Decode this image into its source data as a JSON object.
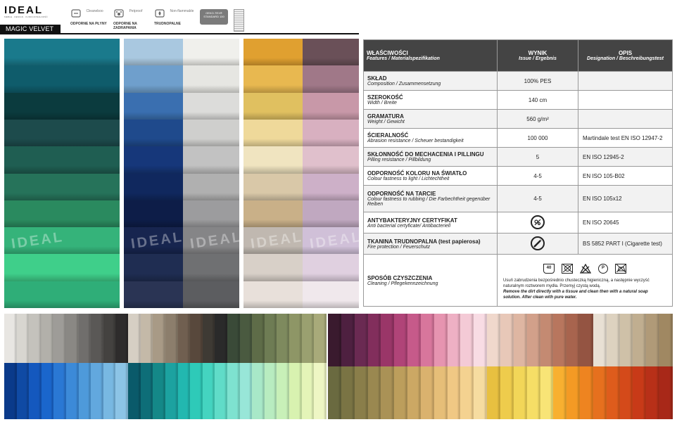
{
  "header": {
    "logo": "IDEAL",
    "logo_tag": "MEBLE · DESIGN · FUNKCJONALNOŚĆ",
    "product_name": "MAGIC VELVET",
    "badges": [
      {
        "icon": "cleaning-icon",
        "en": "Cleaneboo",
        "pl": "ODPORNE NA PŁYNY"
      },
      {
        "icon": "petproof-icon",
        "en": "Petproof",
        "pl": "ODPORNE NA ZADRAPANIA"
      },
      {
        "icon": "flame-icon",
        "en": "Non-flammable",
        "pl": "TRUDNOPALNE"
      }
    ],
    "oeko_text": "OEKO-TEX® STANDARD 100",
    "watermark": "IDEAL"
  },
  "spec_table": {
    "headers": [
      {
        "pl": "WŁAŚCIWOŚCI",
        "en": "Features / Materialspezifikation"
      },
      {
        "pl": "WYNIK",
        "en": "Issue / Ergebnis"
      },
      {
        "pl": "OPIS",
        "en": "Designation / Beschreibungstest"
      }
    ],
    "rows": [
      {
        "pl": "SKŁAD",
        "en": "Composition / Zusammensetzung",
        "result": "100% PES",
        "desc": ""
      },
      {
        "pl": "SZEROKOŚĆ",
        "en": "Width / Breite",
        "result": "140 cm",
        "desc": ""
      },
      {
        "pl": "GRAMATURA",
        "en": "Weight / Gewicht",
        "result": "560 g/m²",
        "desc": ""
      },
      {
        "pl": "ŚCIERALNOŚĆ",
        "en": "Abrasion resistance / Scheuer bestandigkeit",
        "result": "100 000",
        "desc": "Martindale test EN ISO 12947-2"
      },
      {
        "pl": "SKŁONNOŚĆ DO MECHACENIA I PILLINGU",
        "en": "Pilling resistance / Pillbildung",
        "result": "5",
        "desc": "EN ISO 12945-2"
      },
      {
        "pl": "ODPORNOŚĆ KOLORU NA ŚWIATŁO",
        "en": "Colour fastness to light / Lichtechtheit",
        "result": "4-5",
        "desc": "EN ISO 105-B02"
      },
      {
        "pl": "ODPORNOŚĆ NA TARCIE",
        "en": "Colour fastness to rubbing / Die Farbechtheit gegenüber Reiben",
        "result": "4-5",
        "desc": "EN ISO 105x12"
      },
      {
        "pl": "ANTYBAKTERYJNY CERTYFIKAT",
        "en": "Anti bacterial certyficate/ Antibacteriell",
        "result_icon": "antibacterial-icon",
        "desc": "EN ISO 20645"
      },
      {
        "pl": "TKANINA TRUDNOPALNA (test papierosa)",
        "en": "Fire protection / Feuerschutz",
        "result_icon": "cigarette-test-icon",
        "desc": "BS 5852 PART I (Cigarette test)"
      }
    ],
    "cleaning": {
      "pl": "SPOSÓB CZYSZCZENIA",
      "en": "Cleaning / Pflegekennzeichnung",
      "care_symbols": [
        "40",
        "",
        "",
        "P",
        ""
      ],
      "text_pl": "Usuń zabrudzenia bezpośrednio chusteczką higieniczną, a następnie wyczyść naturalnym roztworem mydła. Przemyj czystą wodą.",
      "text_en": "Remove the dirt directly with a tissue and clean then with a natural soap solution. After clean with pure water."
    }
  },
  "colors": {
    "photo1": [
      "#1a7a8c",
      "#0f5c6b",
      "#0b3b3e",
      "#1d4b4c",
      "#1f5e52",
      "#26735a",
      "#2a8a5f",
      "#35b37a",
      "#3fcf8a",
      "#2fae78"
    ],
    "photo2a": [
      "#a9c8e0",
      "#6f9fcc",
      "#3a6fb0",
      "#1f4a8c",
      "#16377a",
      "#10285e",
      "#0d1d48",
      "#17254f",
      "#1f2d52",
      "#2a3454"
    ],
    "photo2b": [
      "#f0f0ec",
      "#e6e6e2",
      "#dcdcda",
      "#cfcfcd",
      "#c2c2c2",
      "#b0b0b0",
      "#9c9c9e",
      "#858587",
      "#6f7072",
      "#5c5d60"
    ],
    "photo3a": [
      "#e0a030",
      "#e8b850",
      "#e0c060",
      "#efd99a",
      "#f0e4c0",
      "#d9c8a8",
      "#c9b088",
      "#c0b8b0",
      "#d8d0c8",
      "#e8e0da"
    ],
    "photo3b": [
      "#6a5058",
      "#a07888",
      "#c898a8",
      "#d8b0c0",
      "#e0c0cc",
      "#cdb0c8",
      "#c0a8c0",
      "#d0c0d8",
      "#e0d0e0",
      "#f0e8ec"
    ],
    "row1": [
      "#e8e6e2",
      "#d8d6d0",
      "#c4c2bc",
      "#b2b0aa",
      "#9e9c98",
      "#8a8884",
      "#706e6c",
      "#5a5856",
      "#444240",
      "#2e2c2c",
      "#d6cfc4",
      "#c4b9a8",
      "#a89a86",
      "#8c7e6c",
      "#705f50",
      "#58483c",
      "#3e3a34",
      "#2a2a2a",
      "#3a4a38",
      "#4a5a40",
      "#5e6c48",
      "#6e7c54",
      "#7e8a5e",
      "#8e9666",
      "#9aa070",
      "#a8aa7a"
    ],
    "row1b": [
      "#3a1a2e",
      "#4e2040",
      "#6a2a52",
      "#822e5c",
      "#9a3668",
      "#b04478",
      "#c65a8a",
      "#d8769c",
      "#e694b0",
      "#eeb0c4",
      "#f4cad6",
      "#f8dce4",
      "#f0d8cc",
      "#e8c8b8",
      "#deb6a2",
      "#d2a08a",
      "#c48a72",
      "#b8765e",
      "#a8644e",
      "#945442",
      "#e8e0d4",
      "#ddd2c0",
      "#cfc1a8",
      "#c0ae90",
      "#b09a78",
      "#a08862"
    ],
    "row2": [
      "#0a3a8a",
      "#0f4aa4",
      "#1458be",
      "#1a66cc",
      "#2a78d4",
      "#3c8ad8",
      "#4e9ada",
      "#62a8de",
      "#78b8e2",
      "#8cc4e6",
      "#0a5a6a",
      "#0e6e78",
      "#148888",
      "#1ca2a0",
      "#22b8b0",
      "#2ecab8",
      "#44d4c0",
      "#60dcc8",
      "#7ee2d0",
      "#98e6d8",
      "#a8e8c8",
      "#b8ecc0",
      "#c8f0b8",
      "#d8f2b0",
      "#e4f4b8",
      "#eef6c4"
    ],
    "row2b": [
      "#6a6a40",
      "#7a7444",
      "#8a7e4a",
      "#9a8850",
      "#aa9256",
      "#bc9e5c",
      "#cca864",
      "#dab26e",
      "#e6be78",
      "#f0c884",
      "#f4d290",
      "#f6dca0",
      "#e8c040",
      "#eecc4c",
      "#f2d658",
      "#f6de66",
      "#f8e476",
      "#f8b030",
      "#f49a24",
      "#ee8420",
      "#e6701e",
      "#de5c1c",
      "#d44a1a",
      "#c83a18",
      "#b83018",
      "#a82818"
    ]
  }
}
